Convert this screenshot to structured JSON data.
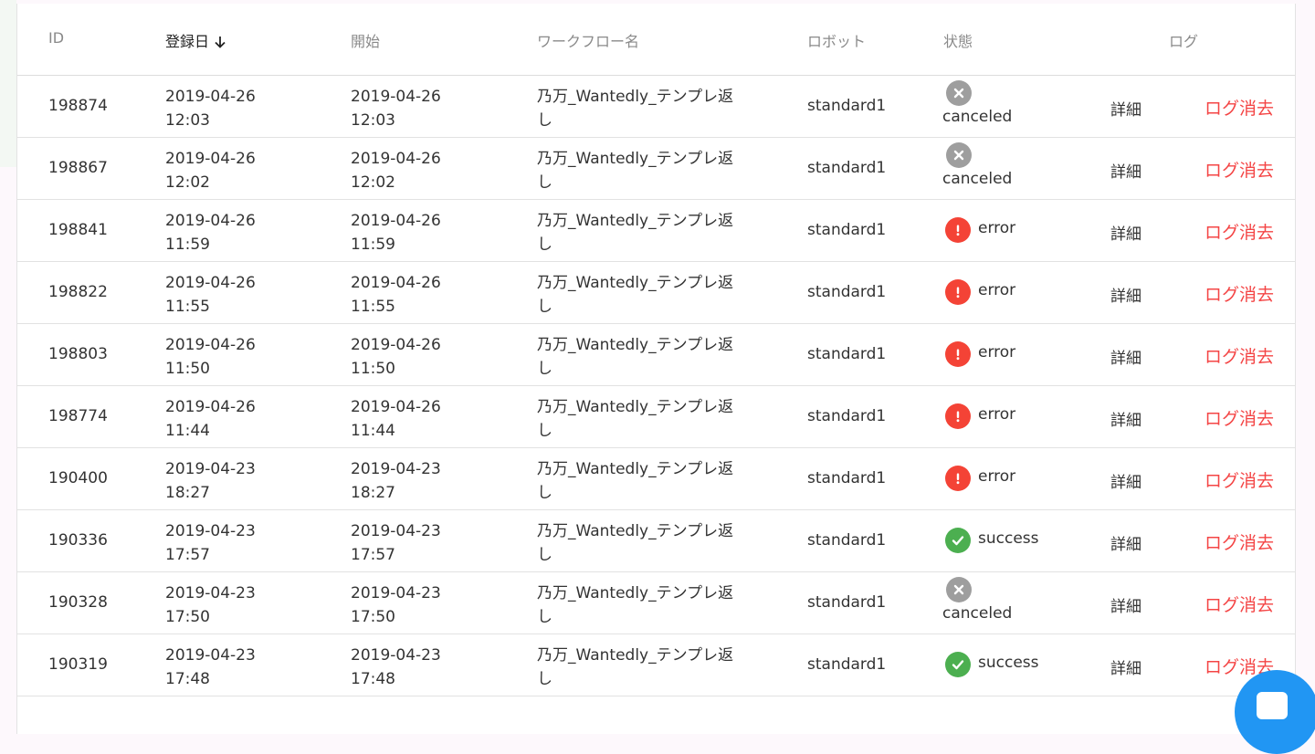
{
  "table": {
    "headers": {
      "id": "ID",
      "registered": "登録日",
      "start": "開始",
      "workflow": "ワークフロー名",
      "robot": "ロボット",
      "status": "状態",
      "log": "ログ"
    },
    "sort_icon": "arrow-down-icon",
    "rows": [
      {
        "id": "198874",
        "reg_date": "2019-04-26",
        "reg_time": "12:03",
        "start_date": "2019-04-26",
        "start_time": "12:03",
        "wf_1": "乃万_Wantedly_テンプレ返",
        "wf_2": "し",
        "robot": "standard1",
        "status": "canceled",
        "detail": "詳細",
        "delete": "ログ消去"
      },
      {
        "id": "198867",
        "reg_date": "2019-04-26",
        "reg_time": "12:02",
        "start_date": "2019-04-26",
        "start_time": "12:02",
        "wf_1": "乃万_Wantedly_テンプレ返",
        "wf_2": "し",
        "robot": "standard1",
        "status": "canceled",
        "detail": "詳細",
        "delete": "ログ消去"
      },
      {
        "id": "198841",
        "reg_date": "2019-04-26",
        "reg_time": "11:59",
        "start_date": "2019-04-26",
        "start_time": "11:59",
        "wf_1": "乃万_Wantedly_テンプレ返",
        "wf_2": "し",
        "robot": "standard1",
        "status": "error",
        "detail": "詳細",
        "delete": "ログ消去"
      },
      {
        "id": "198822",
        "reg_date": "2019-04-26",
        "reg_time": "11:55",
        "start_date": "2019-04-26",
        "start_time": "11:55",
        "wf_1": "乃万_Wantedly_テンプレ返",
        "wf_2": "し",
        "robot": "standard1",
        "status": "error",
        "detail": "詳細",
        "delete": "ログ消去"
      },
      {
        "id": "198803",
        "reg_date": "2019-04-26",
        "reg_time": "11:50",
        "start_date": "2019-04-26",
        "start_time": "11:50",
        "wf_1": "乃万_Wantedly_テンプレ返",
        "wf_2": "し",
        "robot": "standard1",
        "status": "error",
        "detail": "詳細",
        "delete": "ログ消去"
      },
      {
        "id": "198774",
        "reg_date": "2019-04-26",
        "reg_time": "11:44",
        "start_date": "2019-04-26",
        "start_time": "11:44",
        "wf_1": "乃万_Wantedly_テンプレ返",
        "wf_2": "し",
        "robot": "standard1",
        "status": "error",
        "detail": "詳細",
        "delete": "ログ消去"
      },
      {
        "id": "190400",
        "reg_date": "2019-04-23",
        "reg_time": "18:27",
        "start_date": "2019-04-23",
        "start_time": "18:27",
        "wf_1": "乃万_Wantedly_テンプレ返",
        "wf_2": "し",
        "robot": "standard1",
        "status": "error",
        "detail": "詳細",
        "delete": "ログ消去"
      },
      {
        "id": "190336",
        "reg_date": "2019-04-23",
        "reg_time": "17:57",
        "start_date": "2019-04-23",
        "start_time": "17:57",
        "wf_1": "乃万_Wantedly_テンプレ返",
        "wf_2": "し",
        "robot": "standard1",
        "status": "success",
        "detail": "詳細",
        "delete": "ログ消去"
      },
      {
        "id": "190328",
        "reg_date": "2019-04-23",
        "reg_time": "17:50",
        "start_date": "2019-04-23",
        "start_time": "17:50",
        "wf_1": "乃万_Wantedly_テンプレ返",
        "wf_2": "し",
        "robot": "standard1",
        "status": "canceled",
        "detail": "詳細",
        "delete": "ログ消去"
      },
      {
        "id": "190319",
        "reg_date": "2019-04-23",
        "reg_time": "17:48",
        "start_date": "2019-04-23",
        "start_time": "17:48",
        "wf_1": "乃万_Wantedly_テンプレ返",
        "wf_2": "し",
        "robot": "standard1",
        "status": "success",
        "detail": "詳細",
        "delete": "ログ消去"
      }
    ]
  },
  "status_styles": {
    "canceled": {
      "icon": "close-circle-icon",
      "color": "#9e9e9e"
    },
    "error": {
      "icon": "alert-circle-icon",
      "color": "#f44336"
    },
    "success": {
      "icon": "check-circle-icon",
      "color": "#4caf50"
    }
  },
  "colors": {
    "delete_link": "#f44545",
    "chat_button": "#2196f3"
  },
  "chat_widget": {
    "icon": "chat-icon"
  }
}
